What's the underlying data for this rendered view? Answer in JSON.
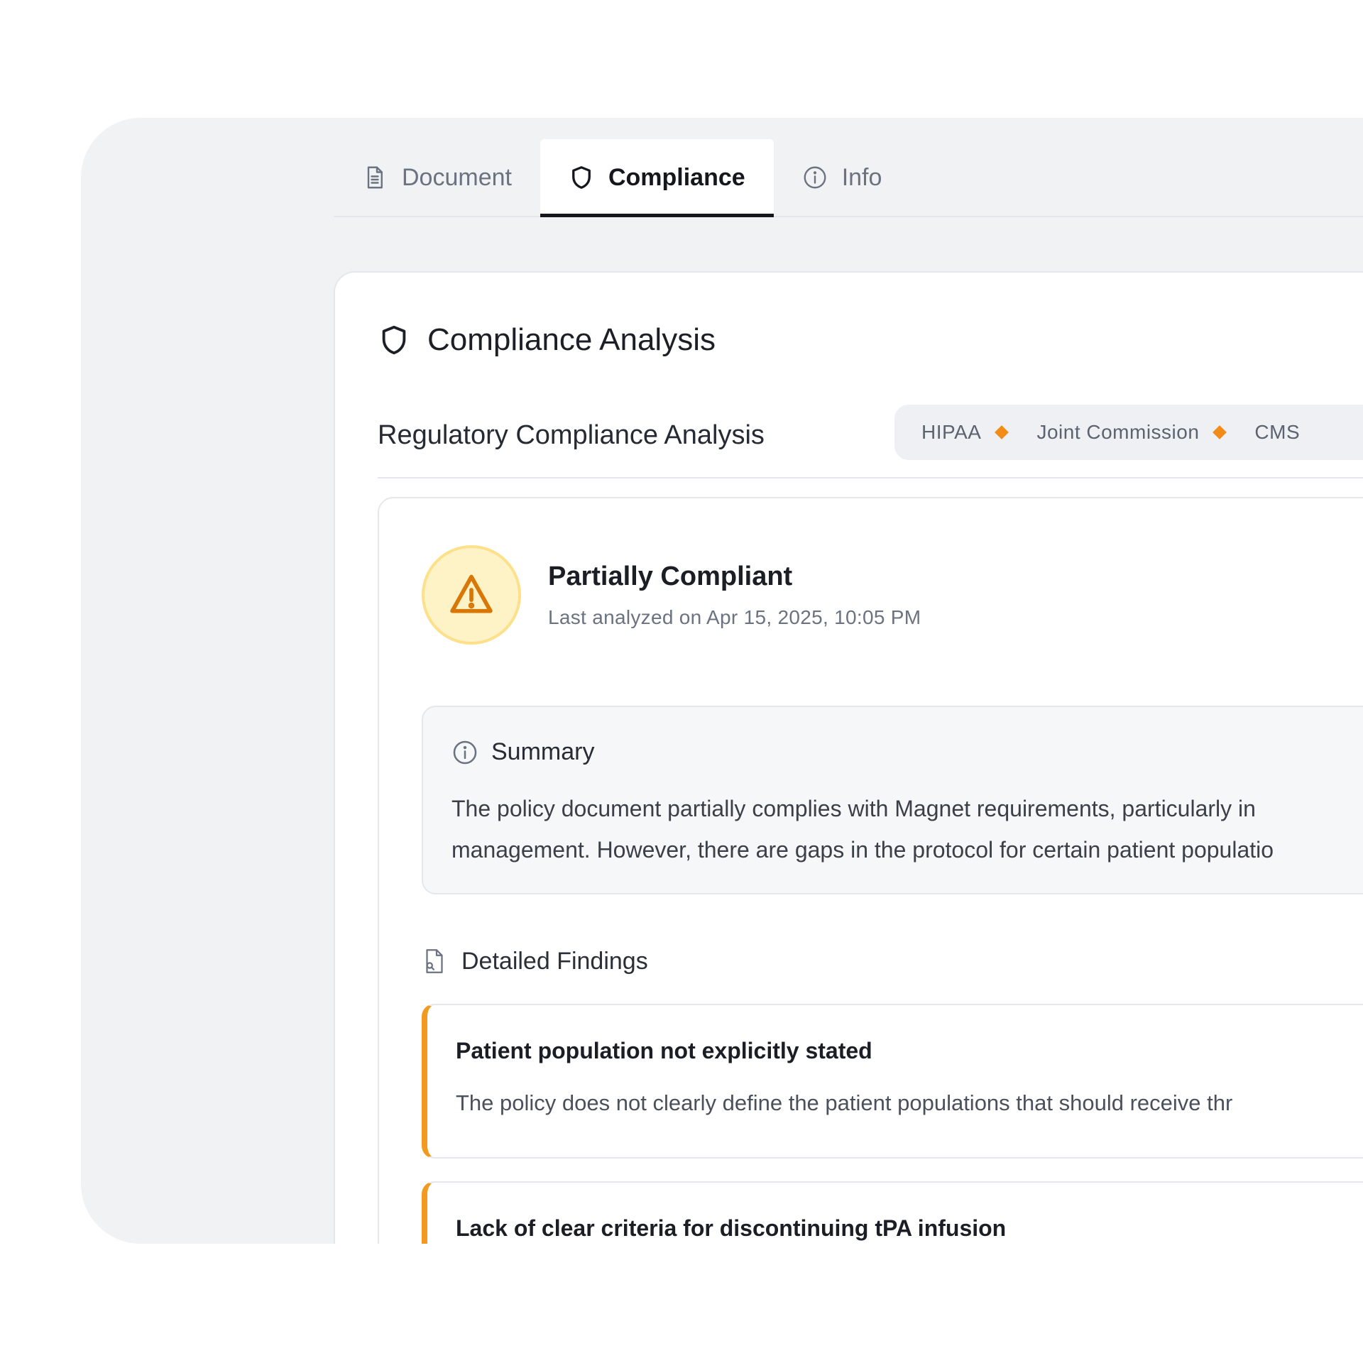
{
  "tabs": [
    {
      "label": "Document",
      "icon": "document-icon",
      "active": false
    },
    {
      "label": "Compliance",
      "icon": "shield-icon",
      "active": true
    },
    {
      "label": "Info",
      "icon": "info-icon",
      "active": false
    }
  ],
  "card": {
    "title": "Compliance Analysis",
    "regulatory_title": "Regulatory Compliance Analysis",
    "tags": [
      "HIPAA",
      "Joint Commission",
      "CMS"
    ],
    "tag_marker_color": "#f28c18"
  },
  "status": {
    "title": "Partially Compliant",
    "last_analyzed": "Last analyzed on Apr 15, 2025, 10:05 PM",
    "icon": "warning-triangle-icon",
    "accent_color": "#d97706"
  },
  "summary": {
    "heading": "Summary",
    "line1": "The policy document partially complies with Magnet requirements, particularly in",
    "line2": "management. However, there are gaps in the protocol for certain patient populatio"
  },
  "findings": {
    "heading": "Detailed Findings",
    "items": [
      {
        "title": "Patient population not explicitly stated",
        "description": "The policy does not clearly define the patient populations that should receive thr"
      },
      {
        "title": "Lack of clear criteria for discontinuing tPA infusion",
        "description": ""
      }
    ],
    "accent_color": "#f29a1f"
  }
}
